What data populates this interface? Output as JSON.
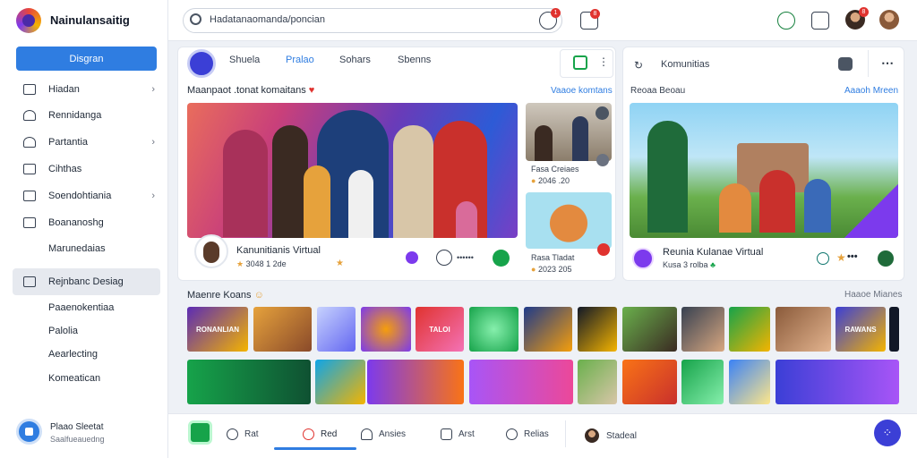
{
  "sidebar": {
    "brand": "Nainulansaitig",
    "primary_button": "Disgran",
    "items": [
      {
        "label": "Hiadan",
        "chevron": true
      },
      {
        "label": "Rennidanga",
        "chevron": false
      },
      {
        "label": "Partantia",
        "chevron": true
      },
      {
        "label": "Cihthas",
        "chevron": false
      },
      {
        "label": "Soendohtiania",
        "chevron": true
      },
      {
        "label": "Boananoshg",
        "chevron": false
      },
      {
        "label": "Marunedaias",
        "chevron": false
      },
      {
        "label": "Rejnbanc Desiag",
        "chevron": false
      },
      {
        "label": "Paaenokentiaa",
        "chevron": false
      },
      {
        "label": "Palolia",
        "chevron": false
      },
      {
        "label": "Aearlecting",
        "chevron": false
      },
      {
        "label": "Komeatican",
        "chevron": false
      }
    ],
    "profile": {
      "name": "Plaao Sleetat",
      "subtitle": "Saalfueauedng"
    }
  },
  "topbar": {
    "search_text": "Hadatanaomanda/poncian",
    "notif_badge_1": "1",
    "notif_badge_2": "8",
    "avatar_badge": "8"
  },
  "main_card": {
    "tabs": [
      "Shuela",
      "Pralao",
      "Sohars",
      "Sbenns"
    ],
    "active_tab": 1,
    "section_title": "Maanpaot .tonat komaitans",
    "section_link": "Vaaoe komtans",
    "featured": {
      "title": "Kanunitianis Virtual",
      "meta": "3048 1 2de"
    },
    "side_items": [
      {
        "title": "Fasa Creiaes",
        "meta": "2046 .20"
      },
      {
        "title": "Rasa Tladat",
        "meta": "2023 205"
      }
    ],
    "reaction_count": "••••••"
  },
  "right_card": {
    "header": "Komunitias",
    "section_title": "Reoaa Beoau",
    "section_link": "Aaaoh Mreen",
    "post": {
      "title": "Reunia Kulanae Virtual",
      "meta": "Kusa 3 rolba"
    }
  },
  "gallery": {
    "title": "Maenre Koans",
    "link": "Haaoe Mianes",
    "tile_labels": {
      "t1": "RONANLIAN",
      "t2": "TALOI",
      "t3": "RAWANS"
    }
  },
  "bottom_bar": {
    "tabs": [
      "Rat",
      "Red",
      "Ansies",
      "Arst",
      "Relias",
      "Stadeal"
    ],
    "active": 1
  }
}
